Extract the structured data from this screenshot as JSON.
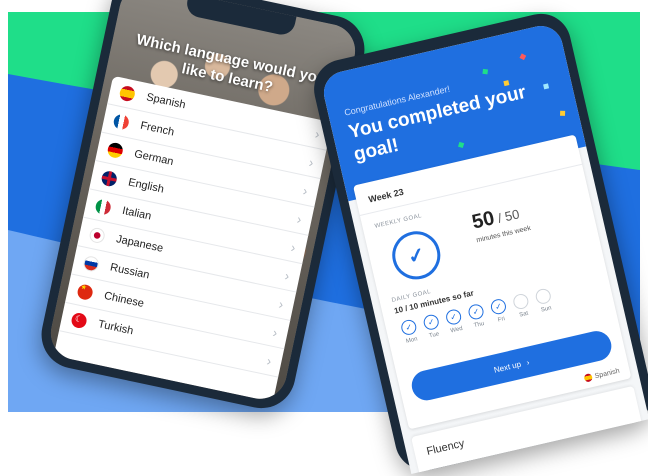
{
  "colors": {
    "green": "#1fde89",
    "blue": "#1f6fe0",
    "light_blue": "#6fa7f3",
    "phone": "#1b2a3a"
  },
  "language_picker": {
    "question": "Which language would you like to learn?",
    "languages": [
      {
        "name": "Spanish",
        "flag": "spain-flag-icon"
      },
      {
        "name": "French",
        "flag": "france-flag-icon"
      },
      {
        "name": "German",
        "flag": "germany-flag-icon"
      },
      {
        "name": "English",
        "flag": "uk-flag-icon"
      },
      {
        "name": "Italian",
        "flag": "italy-flag-icon"
      },
      {
        "name": "Japanese",
        "flag": "japan-flag-icon"
      },
      {
        "name": "Russian",
        "flag": "russia-flag-icon"
      },
      {
        "name": "Chinese",
        "flag": "china-flag-icon"
      },
      {
        "name": "Turkish",
        "flag": "turkey-flag-icon"
      }
    ]
  },
  "goal_screen": {
    "congrats": "Congratulations Alexander!",
    "headline": "You completed your goal!",
    "week": "Week 23",
    "weekly_goal_label": "WEEKLY GOAL",
    "minutes_done": "50",
    "minutes_sep": " / ",
    "minutes_total": "50",
    "minutes_caption": "minutes this week",
    "daily_goal_label": "DAILY GOAL",
    "daily_count": "10 / 10 minutes so far",
    "days": [
      {
        "label": "Mon",
        "done": true
      },
      {
        "label": "Tue",
        "done": true
      },
      {
        "label": "Wed",
        "done": true
      },
      {
        "label": "Thu",
        "done": true
      },
      {
        "label": "Fri",
        "done": true
      },
      {
        "label": "Sat",
        "done": false
      },
      {
        "label": "Sun",
        "done": false
      }
    ],
    "next_button": "Next up",
    "current_language": "Spanish",
    "fluency_title": "Fluency"
  }
}
